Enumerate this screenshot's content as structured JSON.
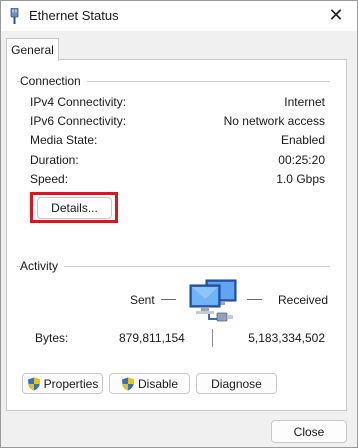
{
  "window": {
    "title": "Ethernet Status",
    "close_glyph": "✕"
  },
  "tabs": [
    {
      "label": "General"
    }
  ],
  "connection": {
    "heading": "Connection",
    "rows": [
      {
        "label": "IPv4 Connectivity:",
        "value": "Internet"
      },
      {
        "label": "IPv6 Connectivity:",
        "value": "No network access"
      },
      {
        "label": "Media State:",
        "value": "Enabled"
      },
      {
        "label": "Duration:",
        "value": "00:25:20"
      },
      {
        "label": "Speed:",
        "value": "1.0 Gbps"
      }
    ],
    "details_label": "Details..."
  },
  "activity": {
    "heading": "Activity",
    "sent_label": "Sent",
    "received_label": "Received",
    "bytes_label": "Bytes:",
    "bytes_sent": "879,811,154",
    "bytes_received": "5,183,334,502",
    "icon": "network-computers-icon"
  },
  "buttons": {
    "properties": "Properties",
    "disable": "Disable",
    "diagnose": "Diagnose",
    "close": "Close"
  },
  "colors": {
    "highlight": "#e0141e",
    "shield_blue": "#2f6fd0",
    "shield_yellow": "#f2c200"
  }
}
